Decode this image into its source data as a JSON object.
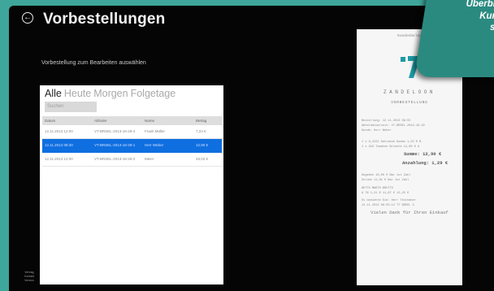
{
  "header": {
    "back_icon": "back-arrow-circle-icon",
    "title": "Vorbestellungen"
  },
  "main": {
    "subtitle": "Vorbestellung zum Bearbeiten auswählen",
    "tabs": [
      {
        "label": "Alle",
        "active": true
      },
      {
        "label": "Heute",
        "active": false
      },
      {
        "label": "Morgen",
        "active": false
      },
      {
        "label": "Folgetage",
        "active": false
      }
    ],
    "search_placeholder": "Suchen",
    "table": {
      "headers": [
        "Datum",
        "Abholer",
        "Name",
        "Betrag"
      ],
      "rows": [
        [
          "12.11.2013 12:00",
          "VT-BRSEL-2013-18-29-4",
          "Frank Müller",
          "7,23 €"
        ],
        [
          "12.11.2013 08:30",
          "VT-BRSEL-2013-18-29-1",
          "Herr Weber",
          "12,90 €"
        ],
        [
          "12.11.2013 12:00",
          "VT-BRSEL-2013-18-29-2",
          "Meier",
          "48,02 €"
        ]
      ],
      "selected_index": 1
    },
    "footer_note": "Vertrag Kontakt Version"
  },
  "receipt": {
    "header": "Kundenbeleg",
    "logo_icon": "company-logo-icon",
    "brand": "ZANDELOON",
    "subheading": "VORBESTELLUNG",
    "lines": [
      "Bestellung:          12.11.2013 09:55",
      "Abholdatum/zeit:     VT-BRSEL-2013-18-29",
      "Kunde:               Herr Weber",
      "1 x 3,2222  Getraenk Kombo     1,22 € B",
      "1 x 319     Tomaten Brioche    11,00 € A"
    ],
    "summe": "Summe:   12,90 €",
    "anzahlung": "Anzahlung:   1,29 €",
    "lines2": [
      "Gegeben       10,00 € Bar 1st Zahl",
      "Zurück         11,61 € Bar 1st Zahl",
      "              NETTO     MWSTR      BRUTTO",
      "A  7%     1,21 €    11,87 €    12,25 €",
      "Es bediente Sie: Herr Testhaber",
      "12.11.2013 09:55:12   TT BRSEL  3"
    ],
    "thanks": "Vielen Dank für Ihren Einkauf"
  },
  "promo": {
    "line1": "Überblick",
    "line2": "Kunde",
    "line3": "stell"
  },
  "colors": {
    "frame": "#3ea69a",
    "screen": "#050505",
    "selection": "#0f6fe0",
    "promo": "#2b8a80"
  }
}
